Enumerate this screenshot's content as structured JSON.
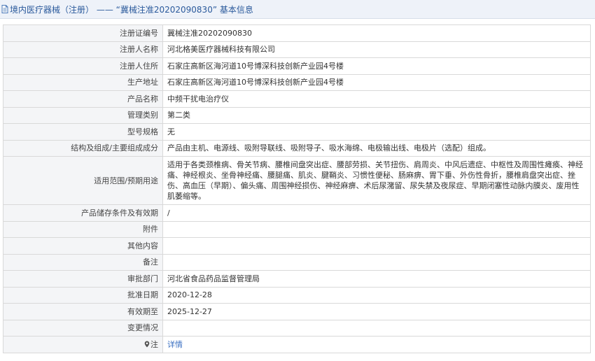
{
  "header": {
    "title": "境内医疗器械（注册） —— “冀械注准20202090830” 基本信息"
  },
  "rows": [
    {
      "label": "注册证编号",
      "value": "冀械注准20202090830"
    },
    {
      "label": "注册人名称",
      "value": "河北格美医疗器械科技有限公司"
    },
    {
      "label": "注册人住所",
      "value": "石家庄高新区海河道10号博深科技创新产业园4号楼"
    },
    {
      "label": "生产地址",
      "value": "石家庄高新区海河道10号博深科技创新产业园4号楼"
    },
    {
      "label": "产品名称",
      "value": "中频干扰电治疗仪"
    },
    {
      "label": "管理类别",
      "value": "第二类"
    },
    {
      "label": "型号规格",
      "value": "无"
    },
    {
      "label": "结构及组成/主要组成成分",
      "value": "产品由主机、电源线、吸附导联线、吸附导子、吸水海绵、电极输出线、电极片（选配）组成。"
    },
    {
      "label": "适用范围/预期用途",
      "value": "适用于各类颈椎病、骨关节病、腰椎间盘突出症、腰部劳损、关节扭伤、肩周炎、中风后遗症、中枢性及周围性瘫痪、神经痛、神经根炎、坐骨神经痛、腰腿痛、肌炎、腱鞘炎、习惯性便秘、肠麻痹、胃下垂、外伤性骨折，腰椎肩盘突出症、挫伤、高血压（早期）、偏头痛、周围神经损伤、神经麻痹、术后尿潴留、尿失禁及夜尿症、早期闭塞性动脉内膜炎、废用性肌萎缩等。"
    },
    {
      "label": "产品储存条件及有效期",
      "value": "/"
    },
    {
      "label": "附件",
      "value": ""
    },
    {
      "label": "其他内容",
      "value": ""
    },
    {
      "label": "备注",
      "value": ""
    },
    {
      "label": "审批部门",
      "value": "河北省食品药品监督管理局"
    },
    {
      "label": "批准日期",
      "value": "2020-12-28"
    },
    {
      "label": "有效期至",
      "value": "2025-12-27"
    },
    {
      "label": "变更情况",
      "value": ""
    },
    {
      "label": "注",
      "value": "详情"
    }
  ],
  "icons": {
    "header": "document-icon",
    "note": "location-pin-icon"
  },
  "colors": {
    "header_bg": "#eef2f9",
    "header_text": "#2b5a9c",
    "label_bg": "#f4f5f7",
    "border": "#d9d9d9",
    "link": "#3a6fc1"
  }
}
